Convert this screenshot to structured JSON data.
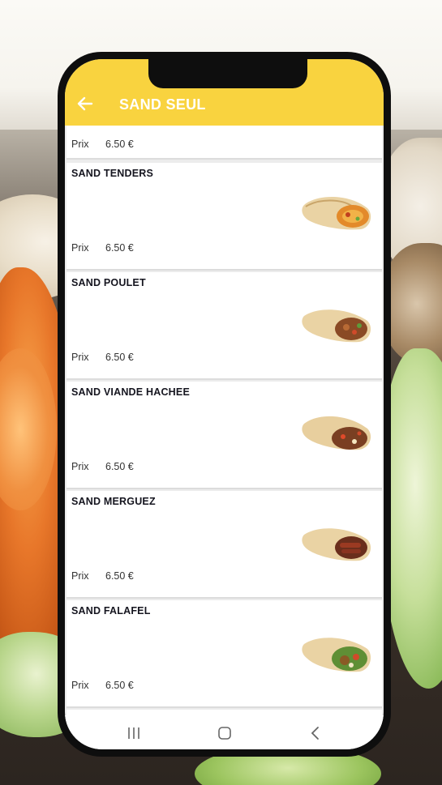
{
  "app": {
    "title": "SAND SEUL",
    "accent_color": "#f9d33f",
    "back_icon": "arrow-left-icon"
  },
  "price_label": "Prix",
  "items": [
    {
      "name": "",
      "price": "6.50 €"
    },
    {
      "name": "SAND TENDERS",
      "price": "6.50 €",
      "image_icon": "wrap-tenders-icon"
    },
    {
      "name": "SAND POULET",
      "price": "6.50 €",
      "image_icon": "wrap-chicken-icon"
    },
    {
      "name": "SAND VIANDE HACHEE",
      "price": "6.50 €",
      "image_icon": "wrap-minced-beef-icon"
    },
    {
      "name": "SAND MERGUEZ",
      "price": "6.50 €",
      "image_icon": "wrap-merguez-icon"
    },
    {
      "name": "SAND FALAFEL",
      "price": "6.50 €",
      "image_icon": "wrap-falafel-icon"
    }
  ],
  "navbar": {
    "recents_icon": "recents-icon",
    "home_icon": "home-icon",
    "back_icon": "back-chevron-icon"
  }
}
